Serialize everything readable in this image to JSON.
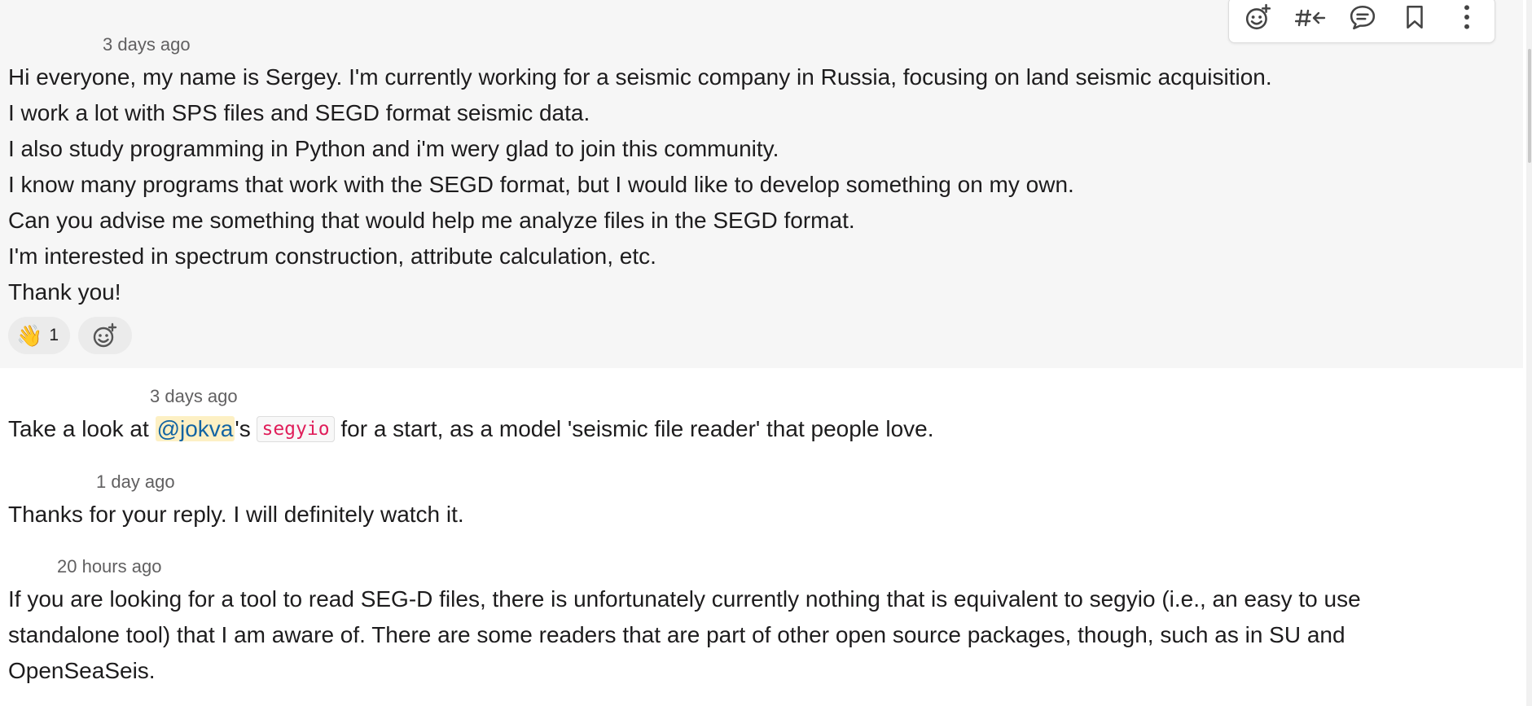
{
  "messages": [
    {
      "timestamp": "3 days ago",
      "lines": [
        "Hi everyone, my name is Sergey. I'm currently working for a seismic company in Russia, focusing on land seismic acquisition.",
        "I work a lot with SPS files and SEGD format seismic data.",
        "I also study programming in Python and i'm wery glad to join this community.",
        "I know many programs that work with the SEGD format, but I would like to develop something on my own.",
        "Can you advise me something that would help me analyze files in the SEGD format.",
        "I'm interested in spectrum construction, attribute calculation, etc.",
        "Thank you!"
      ],
      "reactions": [
        {
          "emoji": "👋",
          "count": "1"
        }
      ]
    },
    {
      "timestamp": "3 days ago",
      "text_before": "Take a look at ",
      "mention": "@jokva",
      "text_mid": "'s ",
      "code": "segyio",
      "text_after": " for a start, as a model 'seismic file reader' that people love."
    },
    {
      "timestamp": "1 day ago",
      "lines": [
        "Thanks for your reply. I will definitely watch it."
      ]
    },
    {
      "timestamp": "20 hours ago",
      "lines": [
        "If you are looking for a tool to read SEG-D files, there is unfortunately currently nothing that is equivalent to segyio (i.e., an easy to use",
        "standalone tool) that I am aware of. There are some readers that are part of other open source packages, though, such as in SU and",
        "OpenSeaSeis."
      ]
    }
  ],
  "toolbar": {
    "icons": [
      "add-reaction-icon",
      "reply-in-channel-icon",
      "reply-in-thread-icon",
      "bookmark-icon",
      "more-actions-icon"
    ]
  },
  "colors": {
    "hover_background": "#f6f6f6",
    "mention_background": "#fdf0c4",
    "mention_text": "#1264a3",
    "code_text": "#e01e5a",
    "timestamp": "#616061"
  }
}
